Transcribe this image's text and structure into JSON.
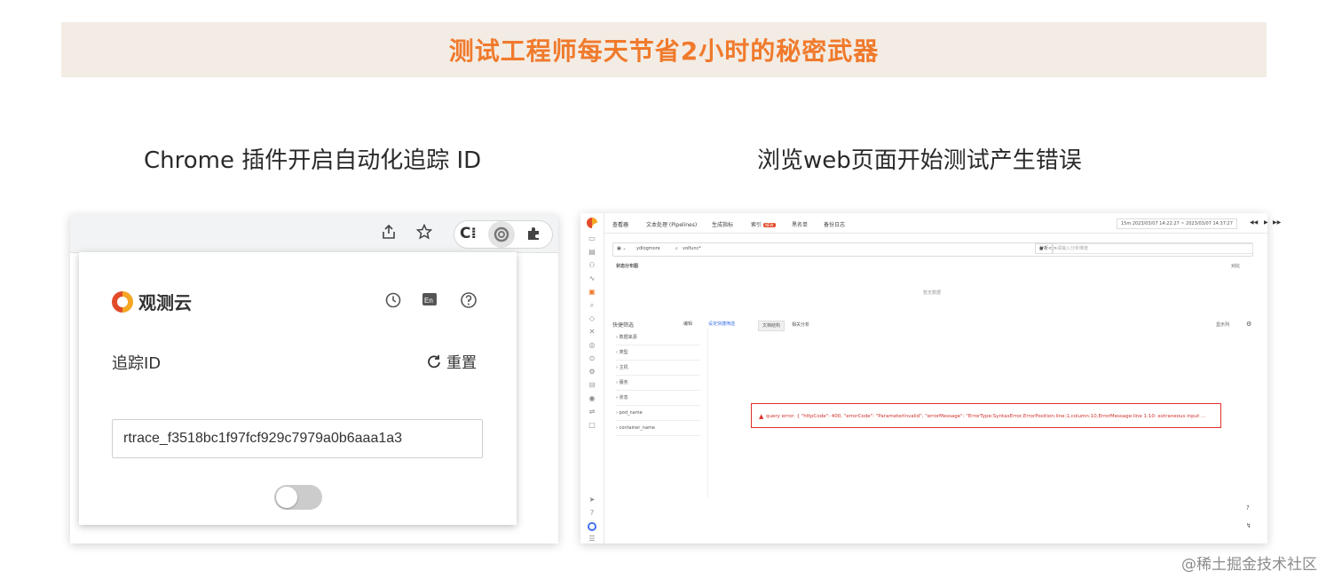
{
  "banner": {
    "title": "测试工程师每天节省2小时的秘密武器"
  },
  "captions": {
    "left": "Chrome 插件开启自动化追踪 ID",
    "right": "浏览web页面开始测试产生错误"
  },
  "chrome_toolbar": {
    "icons": [
      "share-icon",
      "star-icon",
      "extension-c-icon",
      "guance-extension-icon",
      "puzzle-icon"
    ]
  },
  "popup": {
    "logo_text": "观测云",
    "trace_label": "追踪ID",
    "reset_label": "重置",
    "trace_value": "rtrace_f3518bc1f97fcf929c7979a0b6aaa1a3",
    "toggle_on": false
  },
  "webapp": {
    "tabs": [
      {
        "label": "查看器"
      },
      {
        "label": "文本处理 (Pipelines)"
      },
      {
        "label": "生成指标"
      },
      {
        "label": "索引",
        "badge": "NEW"
      },
      {
        "label": "黑名单"
      },
      {
        "label": "备份日志"
      }
    ],
    "time_range": "15m  2023/03/07 14:22:27 ~ 2023/03/07 14:37:27",
    "source_select": "ydlogmore",
    "search_text": "volfunc*",
    "analysis_button": "分析",
    "analysis_placeholder": "请输入分析维度",
    "status_section": "状态分布图",
    "status_right": "对比",
    "empty_text": "暂无数据",
    "quick_filter": "快捷筛选",
    "edit": "编辑",
    "set_filter": "设定快捷筛选",
    "query_tabs": [
      "文档结构",
      "相关分析"
    ],
    "right_action": "显示列",
    "filters": [
      "数据来源",
      "类型",
      "主机",
      "服务",
      "状态",
      "pod_name",
      "container_name"
    ],
    "error_text": "query error: { \"httpCode\": 400, \"errorCode\": \"ParameterInvalid\", \"errorMessage\": \"ErrorType:SyntaxError,ErrorPosition:line:1,column:10,ErrorMessage:line 1:10: extraneous input ..."
  },
  "watermark": "@稀土掘金技术社区"
}
